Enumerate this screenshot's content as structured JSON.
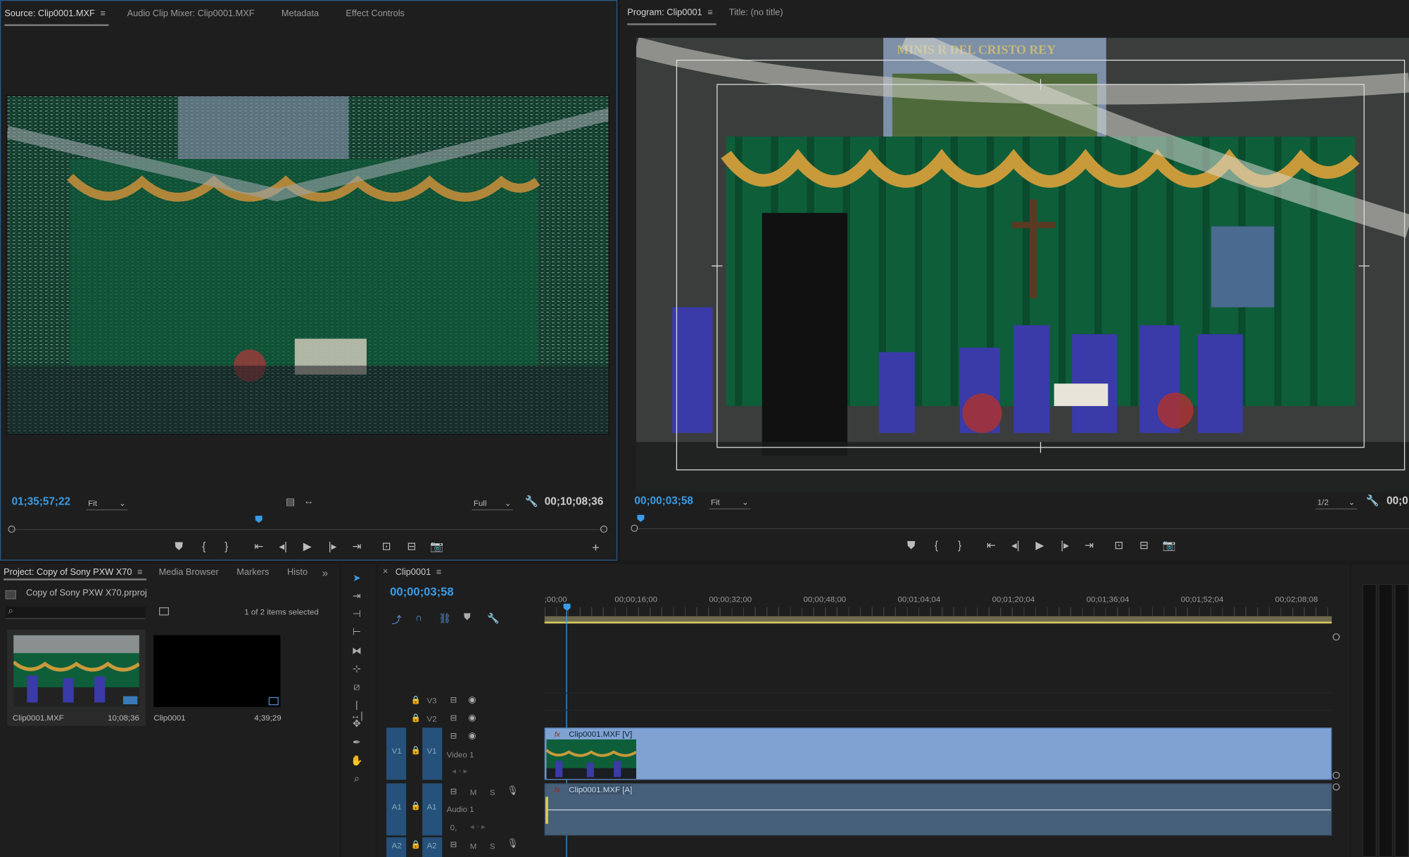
{
  "source": {
    "tabs": [
      {
        "label": "Source: Clip0001.MXF",
        "active": true
      },
      {
        "label": "Audio Clip Mixer: Clip0001.MXF"
      },
      {
        "label": "Metadata"
      },
      {
        "label": "Effect Controls"
      }
    ],
    "menu": "≡",
    "timecode_current": "01;35;57;22",
    "fit": "Fit",
    "resolution": "Full",
    "timecode_duration": "00;10;08;36",
    "playhead_fraction": 0.42
  },
  "program": {
    "tabs": [
      {
        "label": "Program: Clip0001",
        "active": true
      },
      {
        "label": "Title: (no title)"
      }
    ],
    "menu": "≡",
    "timecode_current": "00;00;03;58",
    "fit": "Fit",
    "resolution": "1/2",
    "timecode_duration": "00;0",
    "banner": "MINIS  R    DEL CRISTO REY"
  },
  "project": {
    "tabs": [
      {
        "label": "Project: Copy of Sony PXW X70",
        "active": true
      },
      {
        "label": "Media Browser"
      },
      {
        "label": "Markers"
      },
      {
        "label": "Histo"
      }
    ],
    "more": "»",
    "menu": "≡",
    "file": "Copy of Sony PXW X70.prproj",
    "selection": "1 of 2 items selected",
    "items": [
      {
        "name": "Clip0001.MXF",
        "duration": "10;08;36"
      },
      {
        "name": "Clip0001",
        "duration": "4;39;29"
      }
    ]
  },
  "timeline": {
    "close": "×",
    "tab": "Clip0001",
    "menu": "≡",
    "timecode": "00;00;03;58",
    "ruler": [
      ";00;00",
      "00;00;16;00",
      "00;00;32;00",
      "00;00;48;00",
      "00;01;04;04",
      "00;01;20;04",
      "00;01;36;04",
      "00;01;52;04",
      "00;02;08;08"
    ],
    "tracks": {
      "v3": "V3",
      "v2": "V2",
      "v1": "V1",
      "v1_src": "V1",
      "video1": "Video 1",
      "a1": "A1",
      "a1_src": "A1",
      "audio1": "Audio 1",
      "a2": "A2",
      "a2_src": "A2",
      "m": "M",
      "s": "S"
    },
    "clip_video": "Clip0001.MXF [V]",
    "clip_audio": "Clip0001.MXF [A]",
    "fx": "fx",
    "vol": "0,"
  },
  "colors": {
    "accent": "#3a9ce6",
    "clip_video": "#7fa2d3",
    "clip_audio": "#46607a",
    "work_area": "#d8c860"
  }
}
